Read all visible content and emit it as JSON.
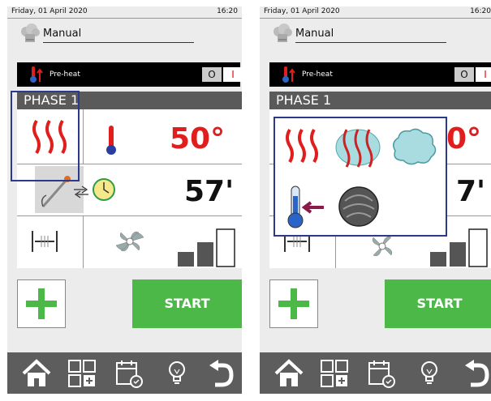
{
  "panels": [
    {
      "status": {
        "date": "Friday, 01 April 2020",
        "time": "16:20"
      },
      "program": {
        "name": "Manual"
      },
      "preheat": {
        "label": "Pre-heat",
        "off_label": "O",
        "on_label": "I"
      },
      "phase": {
        "title": "PHASE 1"
      },
      "settings": {
        "temperature": "50°",
        "time": "57'"
      },
      "actions": {
        "start_label": "START"
      }
    },
    {
      "status": {
        "date": "Friday, 01 April 2020",
        "time": "16:20"
      },
      "program": {
        "name": "Manual"
      },
      "preheat": {
        "label": "Pre-heat",
        "off_label": "O",
        "on_label": "I"
      },
      "phase": {
        "title": "PHASE 1"
      },
      "settings": {
        "temperature": "0°",
        "time": "7'"
      },
      "actions": {
        "start_label": "START"
      }
    }
  ],
  "popup": {
    "options": [
      "dry-heat-icon",
      "combi-heat-steam-icon",
      "steam-icon",
      "cooling-icon",
      "smoke-icon"
    ]
  },
  "colors": {
    "accent_red": "#e01e1e",
    "start_green": "#4cb848",
    "selection_blue": "#2b3a8a",
    "bar_gray": "#5d5d5d"
  }
}
